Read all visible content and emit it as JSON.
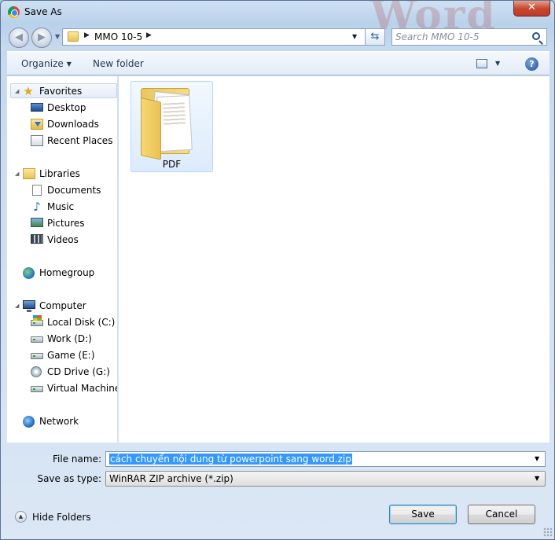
{
  "window": {
    "title": "Save As",
    "watermark": "Word"
  },
  "address": {
    "crumb": "MMO 10-5",
    "search_placeholder": "Search MMO 10-5"
  },
  "toolbar": {
    "organize": "Organize",
    "new_folder": "New folder"
  },
  "nav": {
    "favorites": "Favorites",
    "favorites_items": [
      "Desktop",
      "Downloads",
      "Recent Places"
    ],
    "libraries": "Libraries",
    "libraries_items": [
      "Documents",
      "Music",
      "Pictures",
      "Videos"
    ],
    "homegroup": "Homegroup",
    "computer": "Computer",
    "computer_items": [
      "Local Disk (C:)",
      "Work (D:)",
      "Game (E:)",
      "CD Drive (G:)",
      "Virtual Machine ("
    ],
    "network": "Network"
  },
  "content": {
    "items": [
      {
        "label": "PDF",
        "type": "folder"
      }
    ]
  },
  "form": {
    "filename_label": "File name:",
    "filename_value": "cách chuyển nội dung từ powerpoint sang word.zip",
    "type_label": "Save as type:",
    "type_value": "WinRAR ZIP archive (*.zip)"
  },
  "footer": {
    "hide_folders": "Hide Folders",
    "save": "Save",
    "cancel": "Cancel"
  },
  "colors": {
    "selection": "#3399ff",
    "close_button": "#c74a30",
    "link_text": "#1e395b"
  },
  "icons": {
    "back": "arrow-left-icon",
    "forward": "arrow-right-icon",
    "refresh": "refresh-icon",
    "search": "search-icon",
    "help": "help-icon",
    "close": "close-icon"
  }
}
